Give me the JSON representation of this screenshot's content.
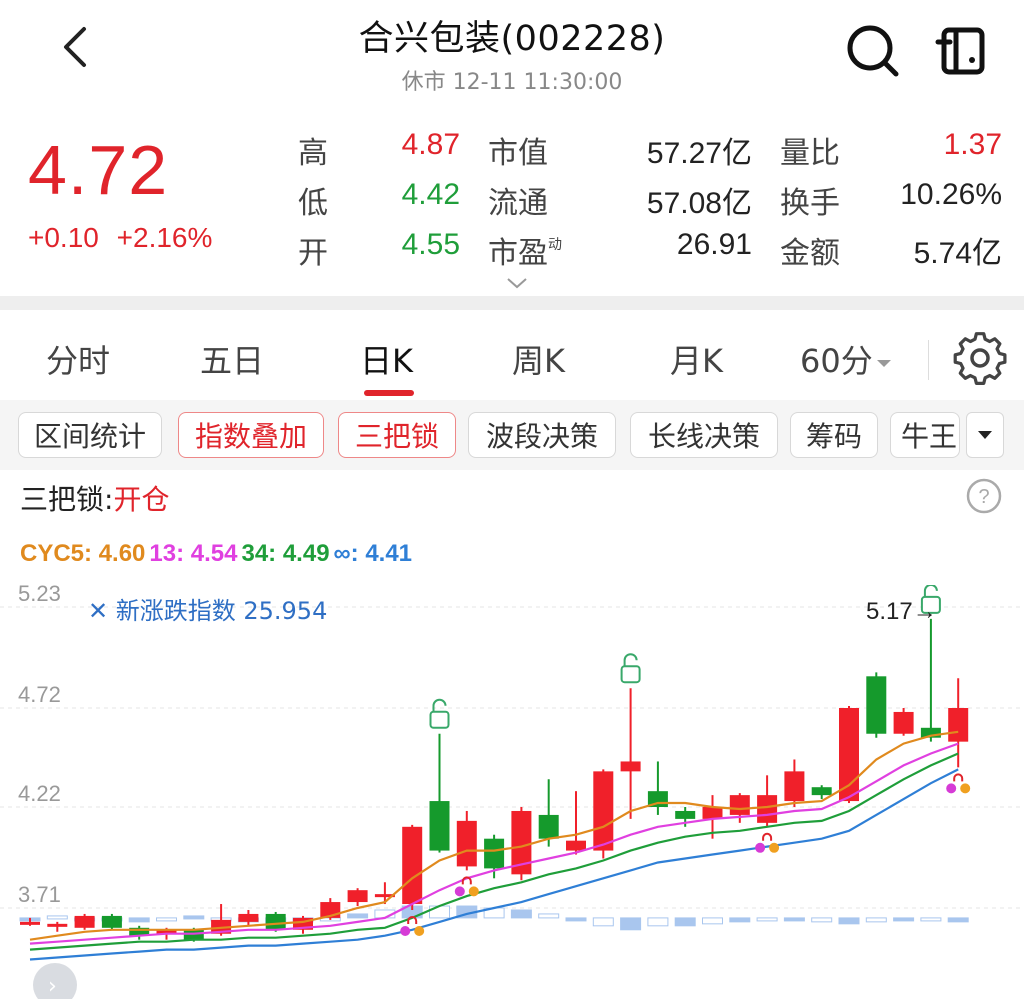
{
  "header": {
    "title": "合兴包装(002228)",
    "subtitle": "休市 12-11 11:30:00"
  },
  "quote": {
    "price": "4.72",
    "change": "+0.10",
    "change_pct": "+2.16%",
    "stats": [
      {
        "label": "高",
        "value": "4.87",
        "color": "red"
      },
      {
        "label": "低",
        "value": "4.42",
        "color": "green"
      },
      {
        "label": "开",
        "value": "4.55",
        "color": "green"
      },
      {
        "label": "市值",
        "value": "57.27亿",
        "color": "dark"
      },
      {
        "label": "流通",
        "value": "57.08亿",
        "color": "dark"
      },
      {
        "label": "市盈",
        "sup": "动",
        "value": "26.91",
        "color": "dark"
      },
      {
        "label": "量比",
        "value": "1.37",
        "color": "red"
      },
      {
        "label": "换手",
        "value": "10.26%",
        "color": "dark"
      },
      {
        "label": "金额",
        "value": "5.74亿",
        "color": "dark"
      }
    ]
  },
  "tabs": [
    "分时",
    "五日",
    "日K",
    "周K",
    "月K",
    "60分"
  ],
  "active_tab": "日K",
  "chips": [
    "区间统计",
    "指数叠加",
    "三把锁",
    "波段决策",
    "长线决策",
    "筹码",
    "牛王"
  ],
  "lock_indicator": {
    "label": "三把锁:",
    "value": "开仓"
  },
  "indicator": {
    "name": "CYC5:",
    "items": [
      {
        "label": "CYC5:",
        "value": "4.60",
        "color": "#e08a1e"
      },
      {
        "label": "13:",
        "value": "4.54",
        "color": "#e040e0"
      },
      {
        "label": "34:",
        "value": "4.49",
        "color": "#1f9e3a"
      },
      {
        "label": "∞:",
        "value": "4.41",
        "color": "#2f7fd6"
      }
    ]
  },
  "chart_data": {
    "type": "candlestick",
    "y_ticks": [
      "5.23",
      "4.72",
      "4.22",
      "3.71"
    ],
    "overlay_label": "新涨跌指数",
    "overlay_value": "25.954",
    "max_label": "5.17→",
    "ylim": [
      3.5,
      5.3
    ],
    "colors": {
      "up": "#f0202a",
      "down": "#159a2c",
      "cyc5": "#e08a1e",
      "c13": "#e040e0",
      "c34": "#1f9e3a",
      "cinf": "#2f7fd6",
      "overlay": "#a9c6ee"
    },
    "candles": [
      {
        "o": 3.64,
        "c": 3.64,
        "h": 3.66,
        "l": 3.62
      },
      {
        "o": 3.62,
        "c": 3.63,
        "h": 3.64,
        "l": 3.59
      },
      {
        "o": 3.61,
        "c": 3.67,
        "h": 3.68,
        "l": 3.6
      },
      {
        "o": 3.67,
        "c": 3.61,
        "h": 3.68,
        "l": 3.6
      },
      {
        "o": 3.61,
        "c": 3.57,
        "h": 3.62,
        "l": 3.55
      },
      {
        "o": 3.58,
        "c": 3.6,
        "h": 3.61,
        "l": 3.55
      },
      {
        "o": 3.6,
        "c": 3.55,
        "h": 3.61,
        "l": 3.54
      },
      {
        "o": 3.58,
        "c": 3.65,
        "h": 3.73,
        "l": 3.57
      },
      {
        "o": 3.64,
        "c": 3.68,
        "h": 3.7,
        "l": 3.62
      },
      {
        "o": 3.68,
        "c": 3.6,
        "h": 3.69,
        "l": 3.59
      },
      {
        "o": 3.6,
        "c": 3.66,
        "h": 3.67,
        "l": 3.58
      },
      {
        "o": 3.66,
        "c": 3.74,
        "h": 3.76,
        "l": 3.65
      },
      {
        "o": 3.74,
        "c": 3.8,
        "h": 3.81,
        "l": 3.72
      },
      {
        "o": 3.78,
        "c": 3.78,
        "h": 3.84,
        "l": 3.73
      },
      {
        "o": 3.73,
        "c": 4.12,
        "h": 4.13,
        "l": 3.7
      },
      {
        "o": 4.25,
        "c": 4.0,
        "h": 4.59,
        "l": 3.99
      },
      {
        "o": 3.92,
        "c": 4.15,
        "h": 4.2,
        "l": 3.9
      },
      {
        "o": 4.06,
        "c": 3.91,
        "h": 4.08,
        "l": 3.86
      },
      {
        "o": 3.88,
        "c": 4.2,
        "h": 4.22,
        "l": 3.85
      },
      {
        "o": 4.18,
        "c": 4.06,
        "h": 4.36,
        "l": 4.02
      },
      {
        "o": 4.0,
        "c": 4.05,
        "h": 4.3,
        "l": 3.98
      },
      {
        "o": 4.0,
        "c": 4.4,
        "h": 4.41,
        "l": 3.96
      },
      {
        "o": 4.4,
        "c": 4.45,
        "h": 4.82,
        "l": 4.16
      },
      {
        "o": 4.3,
        "c": 4.22,
        "h": 4.45,
        "l": 4.18
      },
      {
        "o": 4.2,
        "c": 4.16,
        "h": 4.22,
        "l": 4.12
      },
      {
        "o": 4.16,
        "c": 4.22,
        "h": 4.28,
        "l": 4.06
      },
      {
        "o": 4.18,
        "c": 4.28,
        "h": 4.29,
        "l": 4.14
      },
      {
        "o": 4.14,
        "c": 4.28,
        "h": 4.38,
        "l": 4.12
      },
      {
        "o": 4.25,
        "c": 4.4,
        "h": 4.46,
        "l": 4.22
      },
      {
        "o": 4.32,
        "c": 4.28,
        "h": 4.33,
        "l": 4.26
      },
      {
        "o": 4.25,
        "c": 4.72,
        "h": 4.73,
        "l": 4.24
      },
      {
        "o": 4.88,
        "c": 4.59,
        "h": 4.9,
        "l": 4.57
      },
      {
        "o": 4.59,
        "c": 4.7,
        "h": 4.72,
        "l": 4.58
      },
      {
        "o": 4.62,
        "c": 4.57,
        "h": 5.17,
        "l": 4.55
      },
      {
        "o": 4.55,
        "c": 4.72,
        "h": 4.87,
        "l": 4.42
      }
    ],
    "cyc5": [
      3.55,
      3.57,
      3.59,
      3.6,
      3.6,
      3.6,
      3.6,
      3.61,
      3.62,
      3.63,
      3.64,
      3.67,
      3.71,
      3.74,
      3.86,
      3.95,
      4.0,
      4.0,
      4.02,
      4.06,
      4.08,
      4.12,
      4.2,
      4.24,
      4.24,
      4.22,
      4.21,
      4.22,
      4.24,
      4.25,
      4.33,
      4.46,
      4.54,
      4.58,
      4.6
    ],
    "c13": [
      3.53,
      3.54,
      3.55,
      3.56,
      3.57,
      3.58,
      3.58,
      3.59,
      3.6,
      3.6,
      3.61,
      3.62,
      3.64,
      3.66,
      3.73,
      3.8,
      3.86,
      3.9,
      3.93,
      3.96,
      3.99,
      4.03,
      4.08,
      4.12,
      4.14,
      4.16,
      4.17,
      4.18,
      4.2,
      4.21,
      4.27,
      4.35,
      4.43,
      4.49,
      4.54
    ],
    "c34": [
      3.5,
      3.51,
      3.52,
      3.53,
      3.54,
      3.54,
      3.55,
      3.55,
      3.56,
      3.56,
      3.57,
      3.58,
      3.6,
      3.61,
      3.66,
      3.72,
      3.77,
      3.81,
      3.84,
      3.88,
      3.91,
      3.95,
      4.0,
      4.04,
      4.07,
      4.09,
      4.1,
      4.12,
      4.14,
      4.15,
      4.2,
      4.28,
      4.36,
      4.43,
      4.49
    ],
    "cinf": [
      3.45,
      3.46,
      3.47,
      3.48,
      3.49,
      3.5,
      3.5,
      3.51,
      3.52,
      3.52,
      3.53,
      3.54,
      3.55,
      3.57,
      3.6,
      3.64,
      3.68,
      3.71,
      3.74,
      3.78,
      3.82,
      3.86,
      3.9,
      3.94,
      3.96,
      3.98,
      4.0,
      4.02,
      4.04,
      4.06,
      4.1,
      4.18,
      4.26,
      4.34,
      4.41
    ],
    "overlay": [
      3.66,
      3.67,
      3.66,
      3.65,
      3.64,
      3.66,
      3.67,
      3.65,
      3.64,
      3.63,
      3.64,
      3.66,
      3.68,
      3.7,
      3.72,
      3.72,
      3.72,
      3.71,
      3.7,
      3.68,
      3.66,
      3.62,
      3.6,
      3.62,
      3.62,
      3.63,
      3.64,
      3.65,
      3.65,
      3.64,
      3.63,
      3.64,
      3.65,
      3.65,
      3.64
    ],
    "lock_open_markers": [
      15,
      22,
      33
    ],
    "lock_closed_markers": [
      14,
      16,
      27,
      34
    ]
  }
}
